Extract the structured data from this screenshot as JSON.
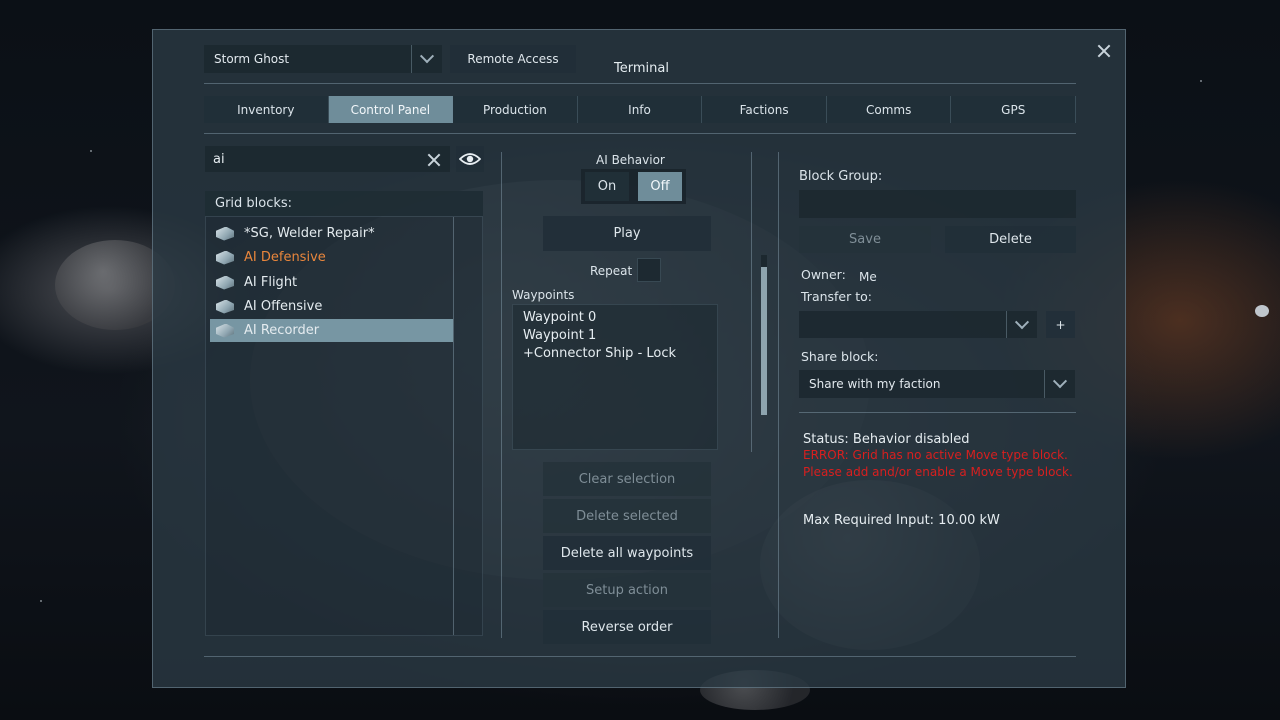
{
  "header": {
    "grid_name": "Storm Ghost",
    "remote_access_label": "Remote Access",
    "title": "Terminal"
  },
  "tabs": [
    {
      "label": "Inventory",
      "active": false
    },
    {
      "label": "Control Panel",
      "active": true
    },
    {
      "label": "Production",
      "active": false
    },
    {
      "label": "Info",
      "active": false
    },
    {
      "label": "Factions",
      "active": false
    },
    {
      "label": "Comms",
      "active": false
    },
    {
      "label": "GPS",
      "active": false
    }
  ],
  "search": {
    "value": "ai"
  },
  "grid_blocks": {
    "header": "Grid blocks:",
    "items": [
      {
        "label": "*SG, Welder Repair*",
        "state": "normal"
      },
      {
        "label": "AI Defensive",
        "state": "highlighted"
      },
      {
        "label": "AI Flight",
        "state": "normal"
      },
      {
        "label": "AI Offensive",
        "state": "normal"
      },
      {
        "label": "AI Recorder",
        "state": "selected"
      }
    ]
  },
  "ai_behavior": {
    "label": "AI Behavior",
    "on_label": "On",
    "off_label": "Off",
    "selected": "Off"
  },
  "play_label": "Play",
  "repeat_label": "Repeat",
  "waypoints": {
    "header": "Waypoints",
    "items": [
      "Waypoint 0",
      "Waypoint 1",
      "+Connector Ship - Lock"
    ]
  },
  "actions": {
    "clear_selection": "Clear selection",
    "delete_selected": "Delete selected",
    "delete_all": "Delete all waypoints",
    "setup_action": "Setup action",
    "reverse_order": "Reverse order"
  },
  "block_group": {
    "label": "Block Group:",
    "value": "",
    "save_label": "Save",
    "delete_label": "Delete"
  },
  "owner": {
    "label": "Owner:",
    "value": "Me",
    "transfer_label": "Transfer to:",
    "transfer_value": "",
    "add_label": "+"
  },
  "share": {
    "label": "Share block:",
    "value": "Share with my faction"
  },
  "status": {
    "line": "Status: Behavior disabled",
    "error": "ERROR: Grid has no active Move type block. Please add and/or enable a Move type block.",
    "power": "Max Required Input: 10.00 kW"
  },
  "colors": {
    "accent": "#6f8d9a",
    "selected_row": "#7796a3",
    "highlight_text": "#e9863c",
    "error_text": "#d81f1f"
  }
}
